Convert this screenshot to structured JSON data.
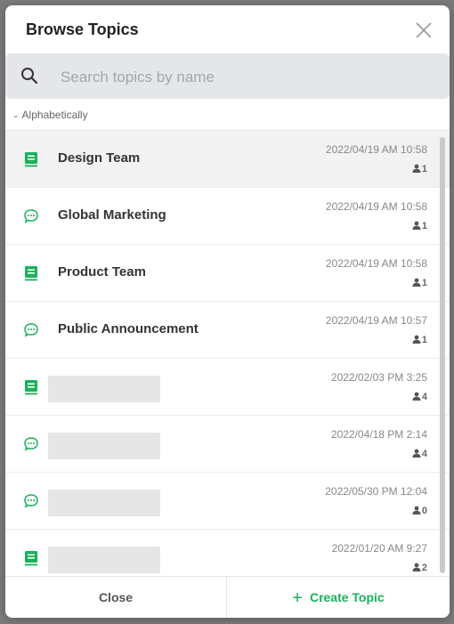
{
  "dialog": {
    "title": "Browse Topics",
    "close_label": "Close",
    "create_label": "Create Topic"
  },
  "search": {
    "placeholder": "Search topics by name",
    "value": ""
  },
  "sort": {
    "label": "Alphabetically"
  },
  "colors": {
    "accent": "#19b15a",
    "selected_row": "#f2f2f2",
    "search_bg": "#e4e6ea"
  },
  "topics": [
    {
      "type": "board",
      "icon": "board-icon",
      "name": "Design Team",
      "date": "2022/04/19 AM 10:58",
      "members": "1",
      "selected": true
    },
    {
      "type": "chat",
      "icon": "chat-bubble-icon",
      "name": "Global Marketing",
      "date": "2022/04/19 AM 10:58",
      "members": "1"
    },
    {
      "type": "board",
      "icon": "board-icon",
      "name": "Product Team",
      "date": "2022/04/19 AM 10:58",
      "members": "1"
    },
    {
      "type": "chat",
      "icon": "chat-bubble-icon",
      "name": "Public Announcement",
      "date": "2022/04/19 AM 10:57",
      "members": "1"
    },
    {
      "type": "board",
      "icon": "board-icon",
      "name": "",
      "redacted": true,
      "date": "2022/02/03 PM 3:25",
      "members": "4"
    },
    {
      "type": "chat",
      "icon": "chat-bubble-icon",
      "name": "",
      "redacted": true,
      "date": "2022/04/18 PM 2:14",
      "members": "4"
    },
    {
      "type": "chat",
      "icon": "chat-bubble-icon",
      "name": "",
      "redacted": true,
      "date": "2022/05/30 PM 12:04",
      "members": "0"
    },
    {
      "type": "board",
      "icon": "board-icon",
      "name": "",
      "redacted": true,
      "date": "2022/01/20 AM 9:27",
      "members": "2"
    }
  ]
}
